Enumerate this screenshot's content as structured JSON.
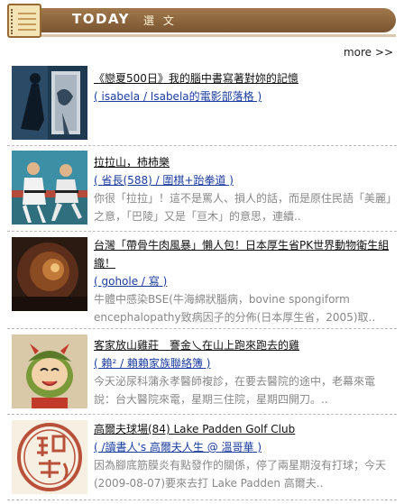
{
  "header": {
    "title": "TODAY",
    "subtitle": "選 文"
  },
  "more_label": "more >>",
  "items": [
    {
      "title": "《戀夏500日》我的腦中書寫著對妳的記憶",
      "author": "( isabela / Isabela的電影部落格 )",
      "excerpt": ""
    },
    {
      "title": "拉拉山，柿柿樂",
      "author": "( 省長(588) / 圍棋+跆拳道 )",
      "excerpt": "你很「拉拉」！這不是罵人、損人的話，而是原住民語「美麗」之意，「巴陵」又是「亘木」的意思，連續.."
    },
    {
      "title": "台灣「帶骨牛肉風暴」懶人包！日本厚生省PK世界動物衛生組織！",
      "author": "( gohole / 寫 )",
      "excerpt": "牛體中感染BSE(牛海綿狀腦病，bovine spongiform encephalopathy致病因子的分佈(日本厚生省，2005)取.."
    },
    {
      "title": "客家放山雞莊　謇金乀在山上跑來跑去的雞",
      "author": "( 賴² / 賴賴家族聯絡簿 )",
      "excerpt": "今天泌尿科蒲永孝醫師複診，在要去醫院的途中，老幕來電說：台大醫院來電，星期三住院，星期四開刀。.."
    },
    {
      "title": "高爾夫球場(84) Lake Padden Golf Club",
      "author": "( /讀書人's 高爾夫人生 @ 溫哥華 )",
      "excerpt": "因為腳底筋膜炎有點發作的關係，停了兩星期沒有打球；今天(2009-08-07)要來去打 Lake Padden 高爾夫.."
    }
  ],
  "stamp_text": "讀書人"
}
